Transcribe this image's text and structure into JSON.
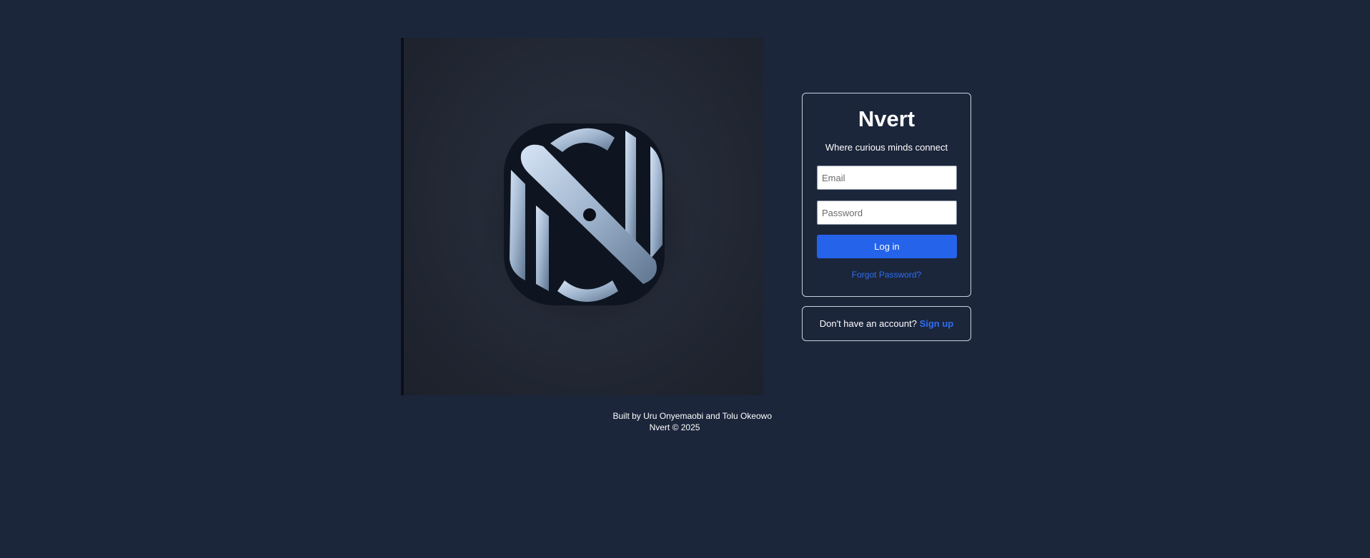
{
  "login": {
    "brand": "Nvert",
    "tagline": "Where curious minds connect",
    "email_placeholder": "Email",
    "password_placeholder": "Password",
    "login_label": "Log in",
    "forgot_label": "Forgot Password?"
  },
  "signup": {
    "prompt": "Don't have an account?",
    "link_label": "Sign up"
  },
  "footer": {
    "credit": "Built by Uru Onyemaobi and Tolu Okeowo",
    "copyright": "Nvert © 2025"
  },
  "hero": {
    "icon": "nvert-logo-icon"
  },
  "colors": {
    "background": "#1b263b",
    "accent": "#2563eb",
    "link": "#2f6df0"
  }
}
